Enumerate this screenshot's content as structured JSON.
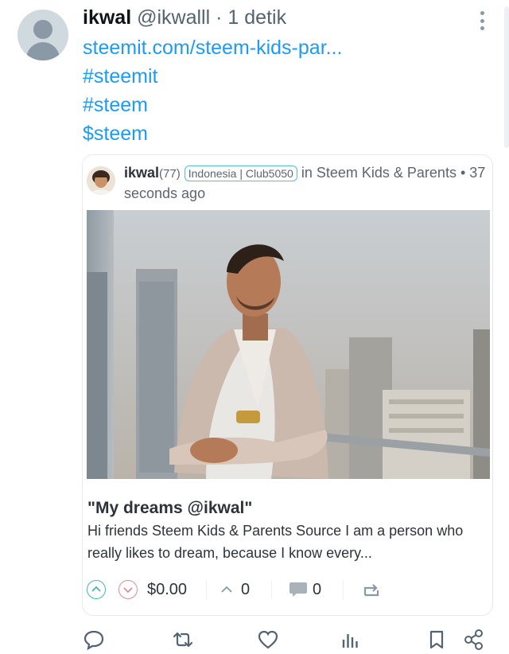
{
  "tweet": {
    "author_name": "ikwal",
    "author_handle": "@ikwalll",
    "separator": "·",
    "time": "1 detik",
    "link": "steemit.com/steem-kids-par...",
    "hashtags": [
      "#steemit",
      "#steem"
    ],
    "cashtag": "$steem"
  },
  "card": {
    "author": "ikwal",
    "reputation": "(77)",
    "community_badge": "Indonesia | Club5050",
    "in_label": "in",
    "community": "Steem Kids & Parents",
    "bullet": "•",
    "posted_time": "37 seconds ago",
    "title": "\"My dreams @ikwal\"",
    "excerpt": "Hi friends Steem Kids & Parents Source I am a person who really likes to dream, because I know every...",
    "payout": "$0.00",
    "votes": "0",
    "comments": "0"
  },
  "colors": {
    "link_blue": "#1d9bf0",
    "upvote_teal": "#43b9a8",
    "downvote_pink": "#e08a97",
    "badge_border": "#4fc3c9",
    "icon_gray": "#536471"
  },
  "icons": {
    "bottom_bar": [
      "reply-icon",
      "retweet-icon",
      "like-icon",
      "views-icon",
      "bookmark-icon",
      "share-icon"
    ]
  }
}
